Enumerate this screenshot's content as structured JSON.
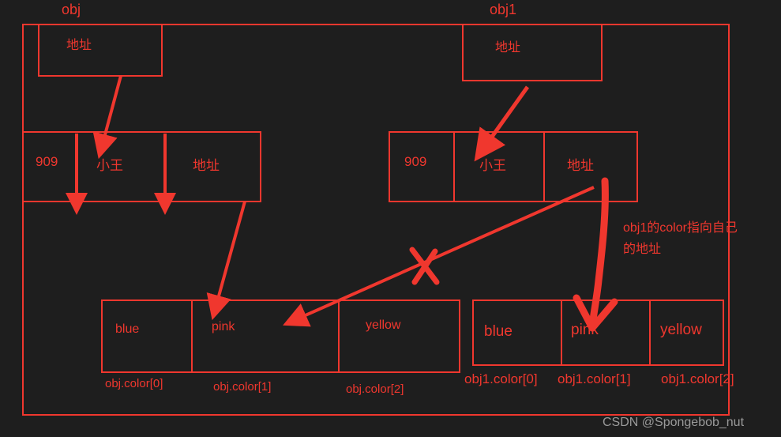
{
  "watermark": "CSDN @Spongebob_nut",
  "colors": {
    "stroke": "#f0372e",
    "background": "#1e1e1e",
    "watermark": "#9a9a9a"
  },
  "annotation": {
    "text": "obj1的color指向自己\n的地址"
  },
  "obj": {
    "title": "obj",
    "address_box_label": "地址",
    "fields": [
      {
        "label": "909"
      },
      {
        "label": "小王"
      },
      {
        "label": "地址"
      }
    ],
    "color_array": {
      "values": [
        "blue",
        "pink",
        "yellow"
      ],
      "labels": [
        "obj.color[0]",
        "obj.color[1]",
        "obj.color[2]"
      ]
    }
  },
  "obj1": {
    "title": "obj1",
    "address_box_label": "地址",
    "fields": [
      {
        "label": "909"
      },
      {
        "label": "小王"
      },
      {
        "label": "地址"
      }
    ],
    "color_array": {
      "values": [
        "blue",
        "pink",
        "yellow"
      ],
      "labels": [
        "obj1.color[0]",
        "obj1.color[1]",
        "obj1.color[2]"
      ]
    }
  },
  "marks": {
    "cross_out": "x-mark"
  }
}
